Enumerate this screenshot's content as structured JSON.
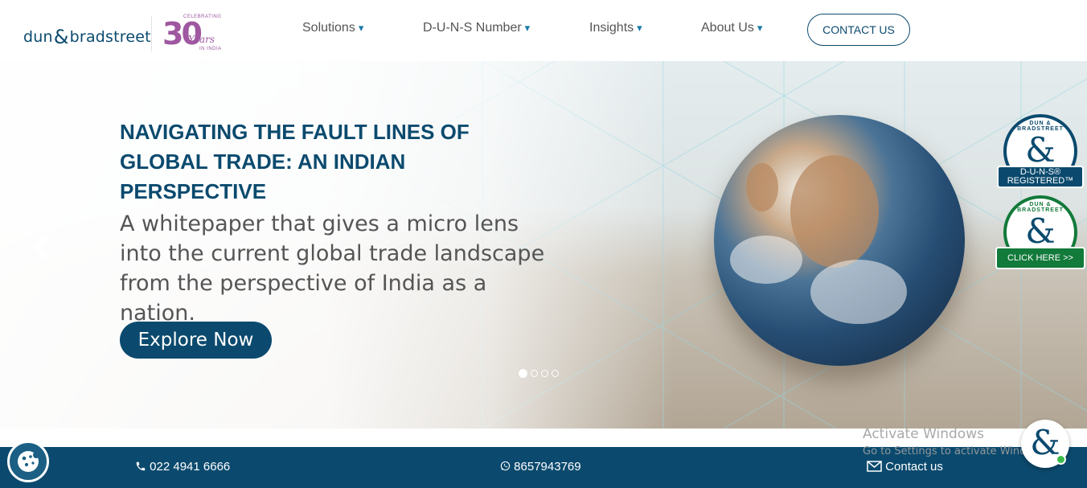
{
  "header": {
    "logo": {
      "left": "dun",
      "amp": "&",
      "right": "bradstreet"
    },
    "anniversary": {
      "line1": "CELEBRATING",
      "number": "30",
      "years": "Years",
      "line2": "IN INDIA"
    },
    "nav": [
      {
        "label": "Solutions"
      },
      {
        "label": "D-U-N-S Number"
      },
      {
        "label": "Insights"
      },
      {
        "label": "About Us"
      }
    ],
    "caret": "▾",
    "contact_label": "CONTACT US"
  },
  "hero": {
    "title": "NAVIGATING THE FAULT LINES OF GLOBAL TRADE: AN INDIAN PERSPECTIVE",
    "subtitle": "A whitepaper that gives a micro lens into the current global trade landscape from the perspective of India as a nation.",
    "cta": "Explore Now",
    "prev_icon": "‹",
    "slides_total": 4,
    "active_slide": 1
  },
  "badges": {
    "registered": {
      "ring": "DUN & BRADSTREET",
      "label_line1": "D-U-N-S®",
      "label_line2": "REGISTERED™",
      "color": "#0b4a6e"
    },
    "click": {
      "ring": "DUN & BRADSTREET",
      "label": "CLICK HERE >>",
      "color": "#127a3a"
    }
  },
  "bottom_bar": {
    "phone": "022 4941 6666",
    "whatsapp": "8657943769",
    "contact": "Contact us"
  },
  "watermark": {
    "line1": "Activate Windows",
    "line2": "Go to Settings to activate Windows."
  },
  "colors": {
    "brand": "#0b4a6e",
    "green": "#127a3a",
    "anniversary": "#9e57a0"
  }
}
